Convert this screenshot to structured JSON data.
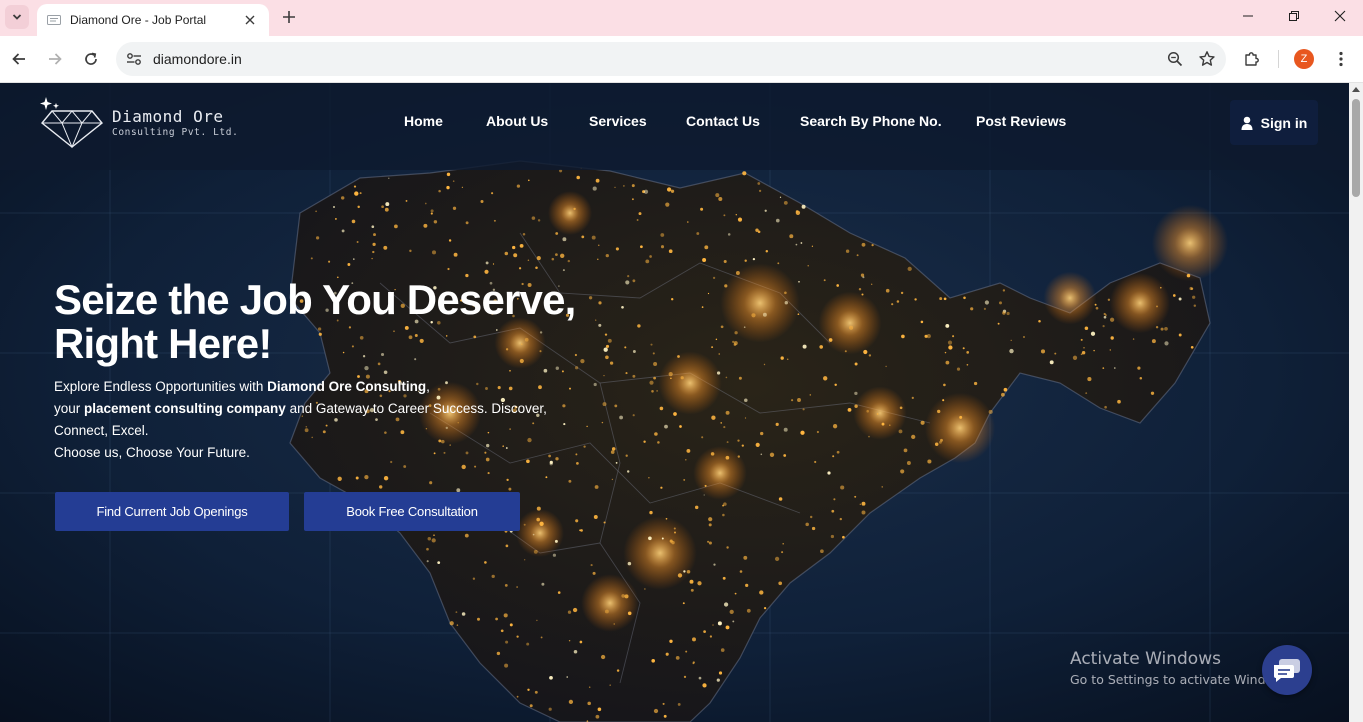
{
  "browser": {
    "tab_title": "Diamond Ore - Job Portal",
    "url": "diamondore.in",
    "profile_initial": "Z"
  },
  "site": {
    "logo": {
      "name": "Diamond Ore",
      "subtitle": "Consulting Pvt. Ltd."
    },
    "nav": [
      "Home",
      "About Us",
      "Services",
      "Contact Us",
      "Search By Phone No.",
      "Post Reviews"
    ],
    "signin_label": "Sign in"
  },
  "hero": {
    "title_line1": "Seize the Job You Deserve,",
    "title_line2": "Right Here!",
    "desc": {
      "p1_a": "Explore Endless Opportunities with ",
      "p1_b": "Diamond Ore Consulting",
      "p1_c": ",",
      "p2_a": "your ",
      "p2_b": "placement consulting company",
      "p2_c": " and Gateway to Career Success. Discover,",
      "p3": "Connect, Excel.",
      "p4": "Choose us, Choose Your Future."
    },
    "cta_primary": "Find Current Job Openings",
    "cta_secondary": "Book Free Consultation"
  },
  "overlay": {
    "activate_title": "Activate Windows",
    "activate_sub": "Go to Settings to activate Windows."
  },
  "colors": {
    "tabstrip": "#fbdfe5",
    "header_bg": "#0e1a2e",
    "cta_bg": "#243d94",
    "signin_bg": "#0f1e3d",
    "map_lights": "#ffb640"
  }
}
